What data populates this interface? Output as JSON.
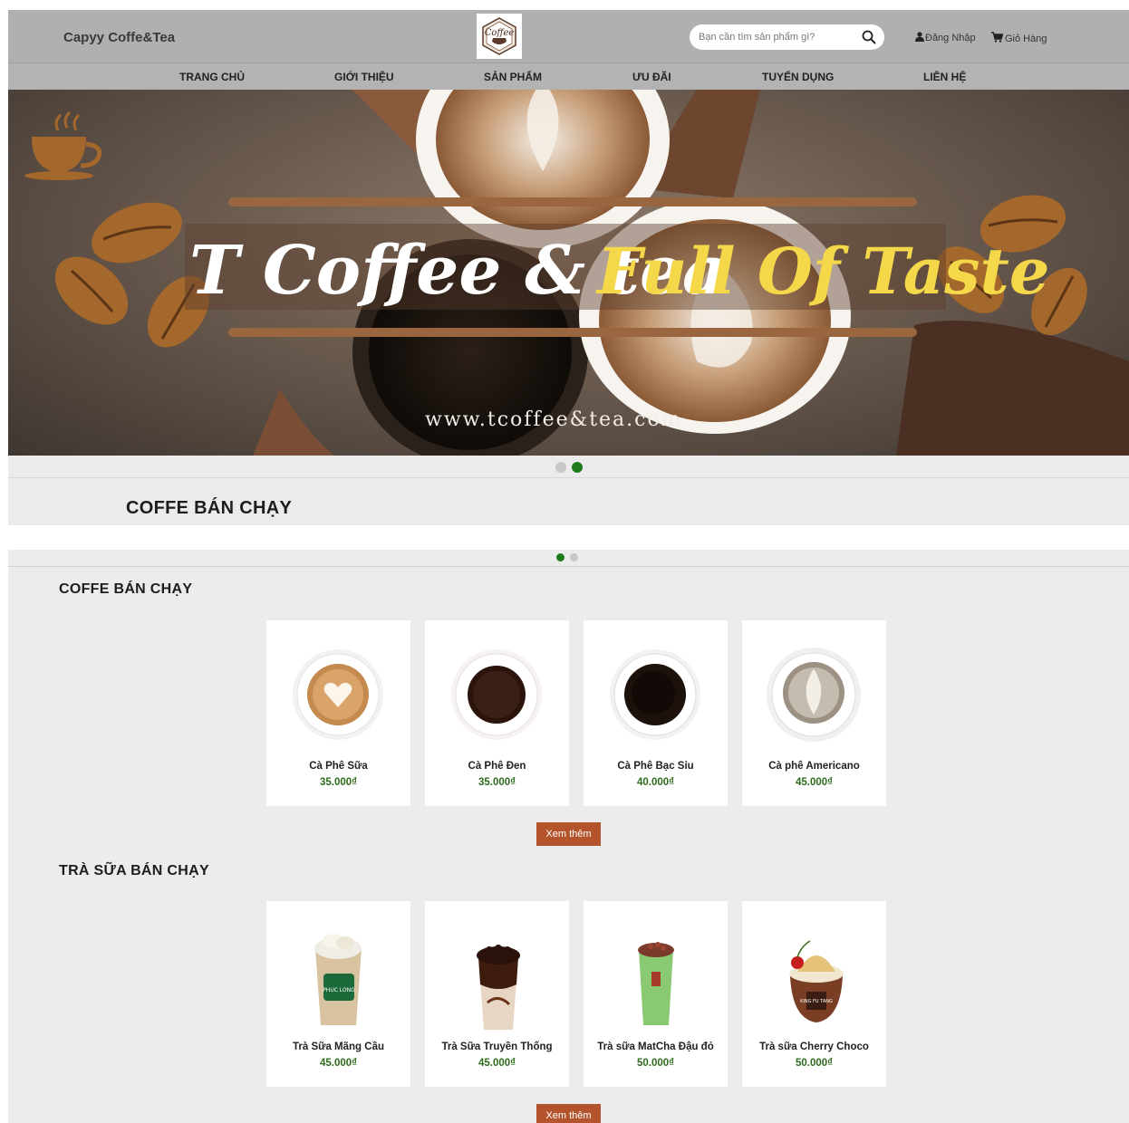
{
  "header": {
    "brand": "Capyy Coffe&Tea",
    "logo_text": "Coffee",
    "search_placeholder": "Bạn cần tìm sản phẩm gì?",
    "login_label": "Đăng Nhập",
    "cart_label": "Giỏ Hàng"
  },
  "nav": {
    "items": [
      "TRANG CHỦ",
      "GIỚI THIỆU",
      "SẢN PHẨM",
      "ƯU ĐÃI",
      "TUYỂN DỤNG",
      "LIÊN HỆ"
    ]
  },
  "banner": {
    "title_left": "T Coffee & tea",
    "title_right": "Full Of Taste",
    "url": "www.tcoffee&tea.com",
    "active_slide": 2,
    "slide_count": 2
  },
  "band": {
    "title": "COFFE BÁN CHẠY"
  },
  "carousel": {
    "active_slide": 1,
    "slide_count": 2
  },
  "coffee": {
    "title": "COFFE BÁN CHẠY",
    "items": [
      {
        "name": "Cà Phê Sữa",
        "price": "35.000₫"
      },
      {
        "name": "Cà Phê Đen",
        "price": "35.000₫"
      },
      {
        "name": "Cà Phê Bạc Sỉu",
        "price": "40.000₫"
      },
      {
        "name": "Cà phê Americano",
        "price": "45.000₫"
      }
    ],
    "more_label": "Xem thêm"
  },
  "milktea": {
    "title": "TRÀ SỮA BÁN CHẠY",
    "items": [
      {
        "name": "Trà Sữa Mãng Cầu",
        "price": "45.000₫"
      },
      {
        "name": "Trà Sữa Truyền Thống",
        "price": "45.000₫"
      },
      {
        "name": "Trà sữa MatCha Đậu đỏ",
        "price": "50.000₫"
      },
      {
        "name": "Trà sữa Cherry Choco",
        "price": "50.000₫"
      }
    ],
    "more_label": "Xem thêm"
  },
  "colors": {
    "accent_button": "#b4542c",
    "price_green": "#2e6b1d",
    "active_dot": "#1d7a1d",
    "inactive_dot": "#c8c8c8"
  }
}
